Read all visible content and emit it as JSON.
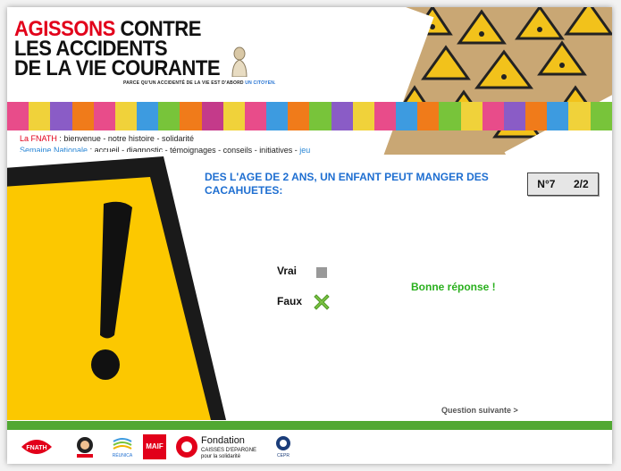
{
  "header": {
    "title_line1_red": "AGISSONS",
    "title_line1_rest": " CONTRE",
    "title_line2": "LES ACCIDENTS",
    "title_line3": "DE LA VIE COURANTE",
    "tagline_main": "PARCE QU'UN ACCIDENTÉ DE LA VIE EST D'ABORD",
    "tagline_blue": "UN CITOYEN."
  },
  "nav": {
    "row1_label": "La FNATH",
    "row1_items": [
      "bienvenue",
      "notre histoire",
      "solidarité"
    ],
    "row2_label": "Semaine Nationale",
    "row2_items": [
      "accueil",
      "diagnostic",
      "témoignages",
      "conseils",
      "initiatives"
    ],
    "row2_active": "jeu"
  },
  "quiz": {
    "question": "DES L'AGE DE 2 ANS, UN ENFANT PEUT MANGER DES CACAHUETES:",
    "number": "N°7",
    "progress": "2/2",
    "answer_true": "Vrai",
    "answer_false": "Faux",
    "feedback": "Bonne réponse !",
    "next": "Question suivante >"
  },
  "footer": {
    "logo_fondation_line1": "Fondation",
    "logo_fondation_line2": "CAISSES D'EPARGNE",
    "logo_fondation_line3": "pour la solidarité",
    "logo_fnath": "FNATH",
    "logo_maif": "MAIF",
    "logo_reunica": "RÉUNICA",
    "logo_cepr": "CEPR"
  },
  "colors": {
    "accent_red": "#e2001a",
    "accent_blue": "#1f6fd1",
    "success_green": "#2ab01e",
    "bar_green": "#51a832",
    "warning_yellow": "#fcc800"
  },
  "icons": {
    "true_option": "gray-square-icon",
    "false_option": "green-x-icon",
    "warning": "warning-triangle-icon"
  }
}
